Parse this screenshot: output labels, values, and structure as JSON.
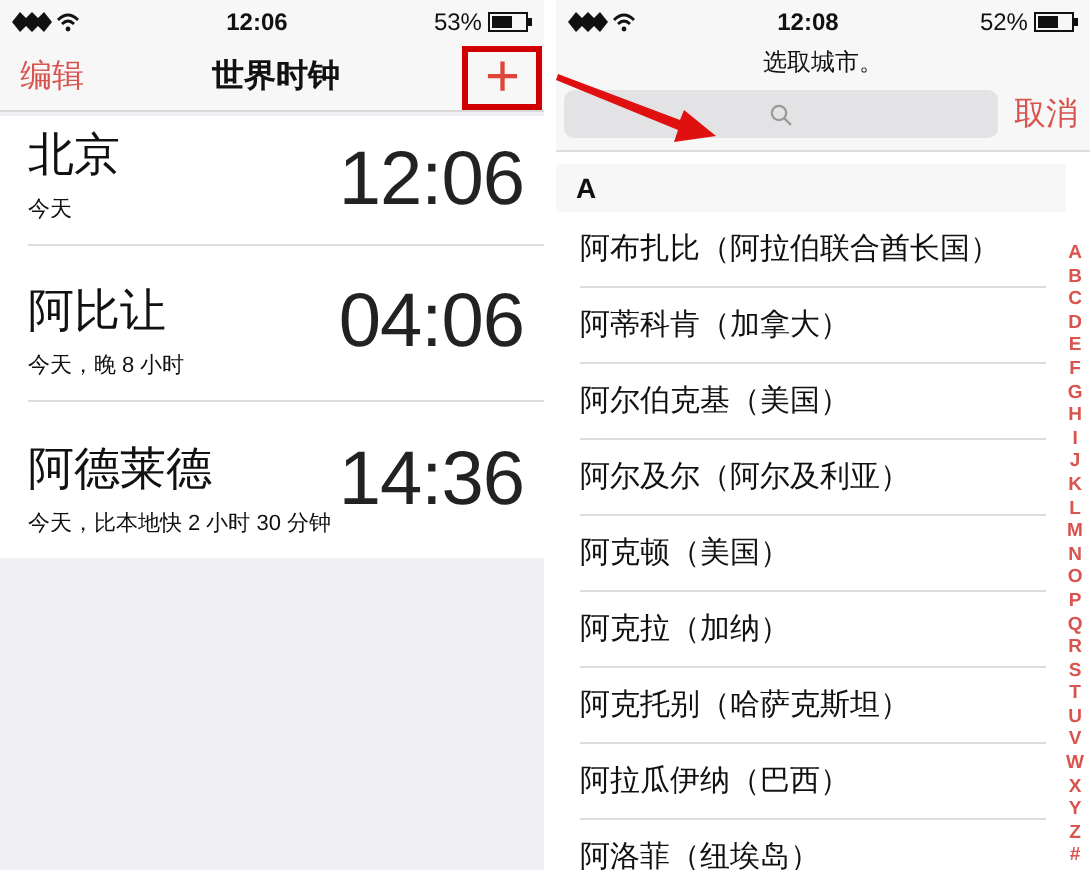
{
  "clock_screen": {
    "status_bar": {
      "time": "12:06",
      "battery": "53%"
    },
    "nav": {
      "edit": "编辑",
      "title": "世界时钟",
      "add": "+",
      "add_annotated": true
    },
    "clocks": [
      {
        "city": "北京",
        "detail": "今天",
        "time": "12:06"
      },
      {
        "city": "阿比让",
        "detail": "今天，晚 8 小时",
        "time": "04:06"
      },
      {
        "city": "阿德莱德",
        "detail": "今天，比本地快 2 小时 30 分钟",
        "time": "14:36"
      }
    ]
  },
  "city_picker": {
    "status_bar": {
      "time": "12:08",
      "battery": "52%"
    },
    "prompt": "选取城市。",
    "cancel": "取消",
    "section": "A",
    "cities": [
      "阿布扎比（阿拉伯联合酋长国）",
      "阿蒂科肯（加拿大）",
      "阿尔伯克基（美国）",
      "阿尔及尔（阿尔及利亚）",
      "阿克顿（美国）",
      "阿克拉（加纳）",
      "阿克托别（哈萨克斯坦）",
      "阿拉瓜伊纳（巴西）",
      "阿洛菲（纽埃岛）"
    ],
    "index": [
      "A",
      "B",
      "C",
      "D",
      "E",
      "F",
      "G",
      "H",
      "I",
      "J",
      "K",
      "L",
      "M",
      "N",
      "O",
      "P",
      "Q",
      "R",
      "S",
      "T",
      "U",
      "V",
      "W",
      "X",
      "Y",
      "Z",
      "#"
    ]
  },
  "annotation": {
    "arrow": true
  }
}
